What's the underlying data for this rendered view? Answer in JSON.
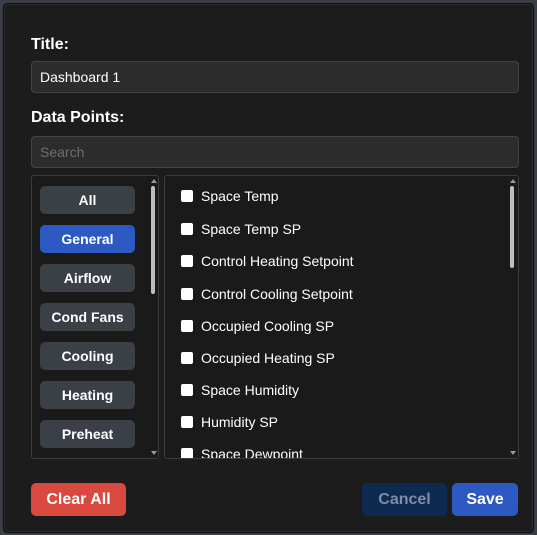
{
  "dialog": {
    "title_label": "Title:",
    "title_value": "Dashboard 1",
    "data_points_label": "Data Points:",
    "search_placeholder": "Search"
  },
  "categories": [
    {
      "label": "All",
      "active": false
    },
    {
      "label": "General",
      "active": true
    },
    {
      "label": "Airflow",
      "active": false
    },
    {
      "label": "Cond Fans",
      "active": false
    },
    {
      "label": "Cooling",
      "active": false
    },
    {
      "label": "Heating",
      "active": false
    },
    {
      "label": "Preheat",
      "active": false
    }
  ],
  "data_points": [
    {
      "label": "Space Temp",
      "checked": false
    },
    {
      "label": "Space Temp SP",
      "checked": false
    },
    {
      "label": "Control Heating Setpoint",
      "checked": false
    },
    {
      "label": "Control Cooling Setpoint",
      "checked": false
    },
    {
      "label": "Occupied Cooling SP",
      "checked": false
    },
    {
      "label": "Occupied Heating SP",
      "checked": false
    },
    {
      "label": "Space Humidity",
      "checked": false
    },
    {
      "label": "Humidity SP",
      "checked": false
    },
    {
      "label": "Space Dewpoint",
      "checked": false
    }
  ],
  "actions": {
    "clear_all": "Clear All",
    "cancel": "Cancel",
    "save": "Save"
  },
  "colors": {
    "primary": "#2d5ac2",
    "danger": "#d9493f",
    "cancel_bg": "#0f2a50",
    "dialog_bg": "#1c1c1c"
  }
}
